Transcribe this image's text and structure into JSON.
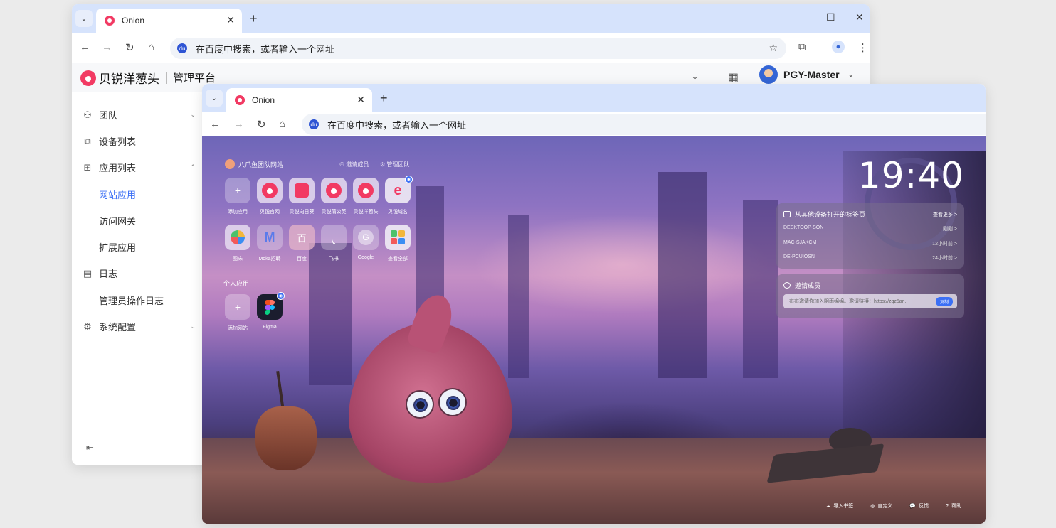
{
  "back_window": {
    "tab_title": "Onion",
    "address_placeholder": "在百度中搜索，或者输入一个网址",
    "brand_name": "贝锐洋葱头",
    "brand_sub": "管理平台",
    "user_name": "PGY-Master",
    "sidebar": {
      "team": "团队",
      "devices": "设备列表",
      "apps": "应用列表",
      "web_apps": "网站应用",
      "gateway": "访问网关",
      "ext_apps": "扩展应用",
      "logs": "日志",
      "admin_logs": "管理员操作日志",
      "config": "系统配置"
    }
  },
  "front_window": {
    "tab_title": "Onion",
    "address_placeholder": "在百度中搜索，或者输入一个网址",
    "team_site": "八爪鱼团队网站",
    "invite_members": "邀请成员",
    "manage_team": "管理团队",
    "team_apps": [
      {
        "label": "添加应用",
        "glyph": "+"
      },
      {
        "label": "贝锐官网",
        "glyph": ""
      },
      {
        "label": "贝锐向日葵",
        "glyph": ""
      },
      {
        "label": "贝锐蒲公英",
        "glyph": ""
      },
      {
        "label": "贝锐洋葱头",
        "glyph": ""
      },
      {
        "label": "贝锐域名",
        "glyph": "e"
      }
    ],
    "team_apps_row2": [
      {
        "label": "图床",
        "glyph": ""
      },
      {
        "label": "Moka招聘",
        "glyph": ""
      },
      {
        "label": "百度",
        "glyph": "百"
      },
      {
        "label": "飞书",
        "glyph": ""
      },
      {
        "label": "Google",
        "glyph": "G"
      },
      {
        "label": "查看全部",
        "glyph": ""
      }
    ],
    "personal_apps_title": "个人应用",
    "personal_apps": [
      {
        "label": "添加网站",
        "glyph": "+"
      },
      {
        "label": "Figma",
        "glyph": ""
      }
    ],
    "clock": "19:40",
    "other_devices": {
      "title": "从其他设备打开的标签页",
      "more": "查看更多 >",
      "items": [
        {
          "name": "DESKTOOP-SON",
          "time": "刚刚 >"
        },
        {
          "name": "MAC-SJAKCM",
          "time": "12小时前 >"
        },
        {
          "name": "DE-PCUIOSN",
          "time": "24小时前 >"
        }
      ]
    },
    "invite_panel": {
      "title": "邀请成员",
      "text": "布布邀请你加入阴雨绵绵。邀请链接：https://zqz5ar...",
      "copy": "复制"
    },
    "footer": {
      "import": "导入书签",
      "customize": "自定义",
      "feedback": "反馈",
      "help": "帮助"
    }
  },
  "colors": {
    "brand": "#f23a63",
    "accent": "#3b6ff5",
    "tabstrip": "#d6e3fc"
  }
}
